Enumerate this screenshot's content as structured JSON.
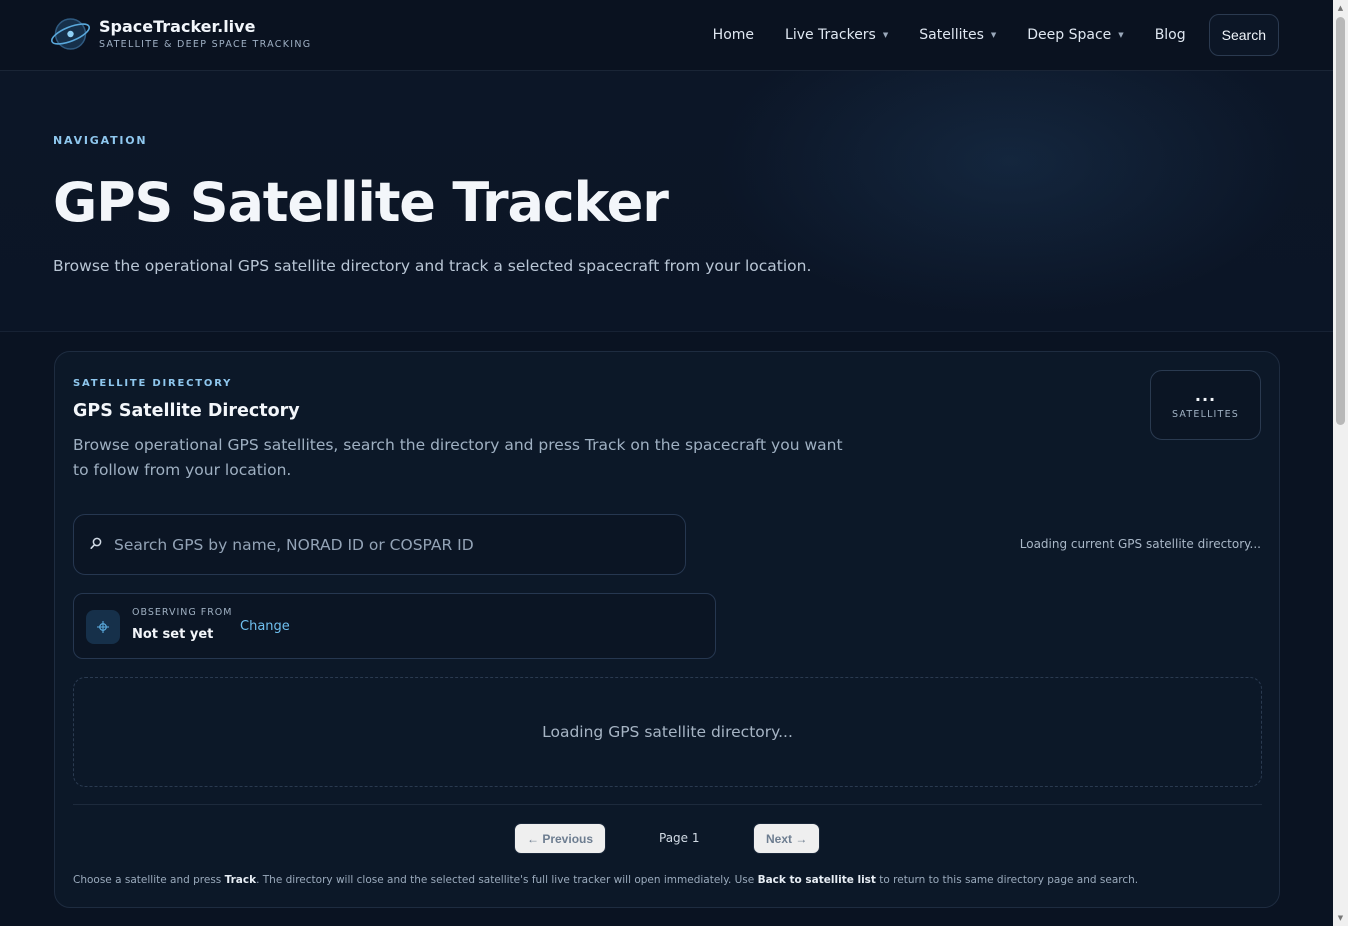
{
  "brand": {
    "name": "SpaceTracker.live",
    "tagline": "SATELLITE & DEEP SPACE TRACKING"
  },
  "nav": {
    "items": [
      {
        "label": "Home",
        "dropdown": false
      },
      {
        "label": "Live Trackers",
        "dropdown": true
      },
      {
        "label": "Satellites",
        "dropdown": true
      },
      {
        "label": "Deep Space",
        "dropdown": true
      },
      {
        "label": "Blog",
        "dropdown": false
      }
    ],
    "search_label": "Search"
  },
  "hero": {
    "kicker": "NAVIGATION",
    "title": "GPS Satellite Tracker",
    "subtitle": "Browse the operational GPS satellite directory and track a selected spacecraft from your location."
  },
  "directory": {
    "kicker": "SATELLITE DIRECTORY",
    "title": "GPS Satellite Directory",
    "description": "Browse operational GPS satellites, search the directory and press Track on the spacecraft you want to follow from your location.",
    "count_value": "...",
    "count_label": "SATELLITES",
    "search_placeholder": "Search GPS by name, NORAD ID or COSPAR ID",
    "search_value": "",
    "status_text": "Loading current GPS satellite directory...",
    "observer": {
      "label": "OBSERVING FROM",
      "value": "Not set yet",
      "change_label": "Change"
    },
    "loading_text": "Loading GPS satellite directory...",
    "pager": {
      "prev_label": "← Previous",
      "page_label": "Page 1",
      "next_label": "Next →"
    },
    "help": {
      "part1": "Choose a satellite and press ",
      "bold1": "Track",
      "part2": ". The directory will close and the selected satellite's full live tracker will open immediately. Use ",
      "bold2": "Back to satellite list",
      "part3": " to return to this same directory page and search."
    }
  },
  "icons": {
    "logo": "orbit-logo-icon",
    "search": "search-icon",
    "location": "crosshair-icon",
    "caret": "caret-down-icon"
  },
  "colors": {
    "accent": "#8fc7ee",
    "link": "#6fc0f0",
    "background": "#0a1322"
  }
}
